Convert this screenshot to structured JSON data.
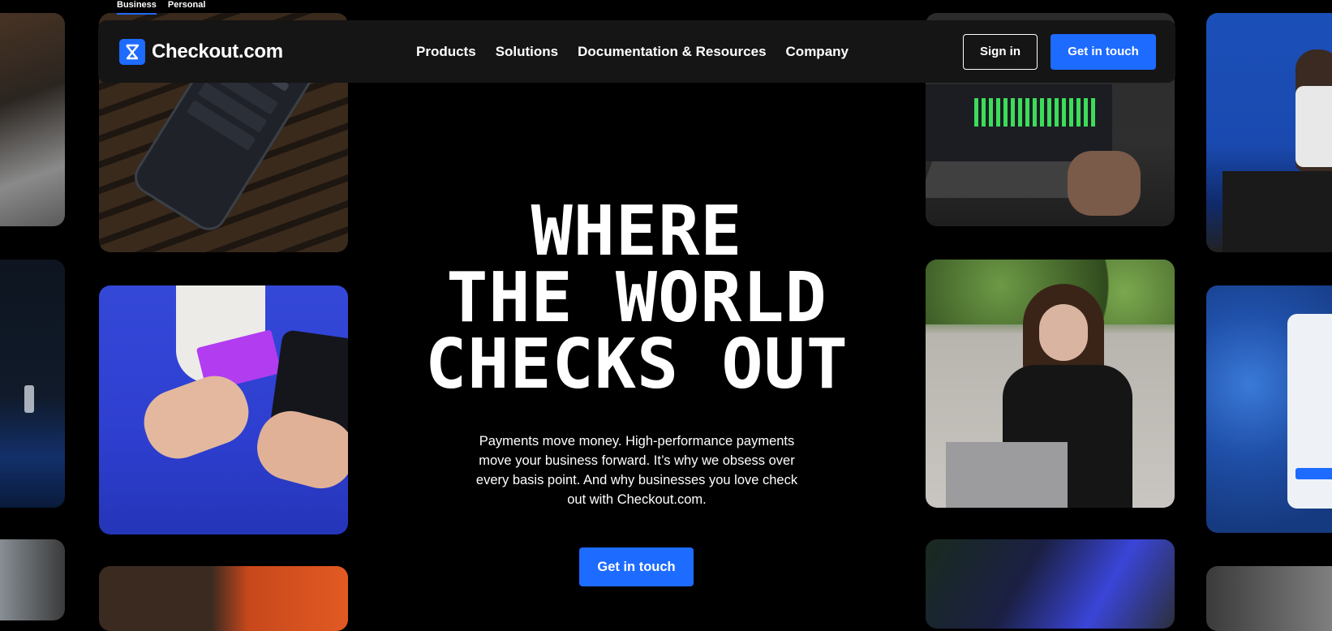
{
  "audience": {
    "business": "Business",
    "personal": "Personal"
  },
  "nav": {
    "brand": "Checkout.com",
    "links": [
      "Products",
      "Solutions",
      "Documentation & Resources",
      "Company"
    ],
    "sign_in": "Sign in",
    "get_in_touch": "Get in touch"
  },
  "hero": {
    "title_lines": [
      "WHERE",
      "THE WORLD",
      "CHECKS OUT"
    ],
    "description": "Payments move money. High-performance payments move your business forward. It’s why we obsess over every basis point. And why businesses you love check out with Checkout.com.",
    "cta": "Get in touch"
  },
  "colors": {
    "accent": "#1d6bff",
    "background": "#000000",
    "navbar": "#151515"
  },
  "icons": {
    "logo": "checkout-logo-icon"
  }
}
